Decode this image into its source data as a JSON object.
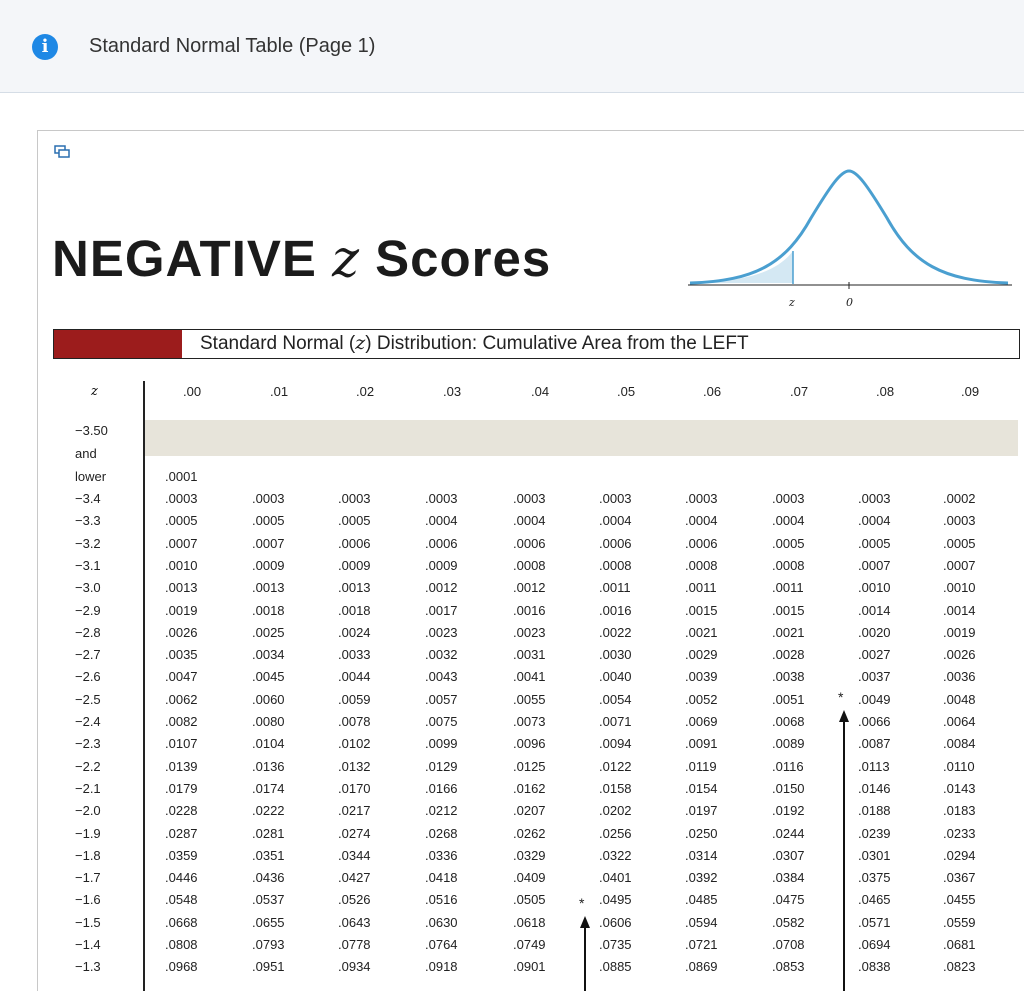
{
  "header": {
    "title": "Standard Normal Table (Page 1)",
    "icon": "info-icon"
  },
  "figure": {
    "title_prefix": "NEGATIVE ",
    "title_z": "z",
    "title_suffix": " Scores",
    "curve": {
      "label_z": "z",
      "label_zero": "0",
      "color": "#4a9fd0",
      "shade": "#d4e8f3"
    },
    "distribution_label_pre": "Standard Normal (",
    "distribution_label_z": "z",
    "distribution_label_post": ") Distribution: Cumulative Area from the LEFT",
    "accent": "#9c1c1c"
  },
  "table": {
    "z_header": "z",
    "columns": [
      ".00",
      ".01",
      ".02",
      ".03",
      ".04",
      ".05",
      ".06",
      ".07",
      ".08",
      ".09"
    ],
    "first_row": {
      "z": [
        "−3.50",
        "and",
        "lower"
      ],
      "values": [
        ".0001"
      ]
    },
    "rows": [
      {
        "z": "−3.4",
        "values": [
          ".0003",
          ".0003",
          ".0003",
          ".0003",
          ".0003",
          ".0003",
          ".0003",
          ".0003",
          ".0003",
          ".0002"
        ]
      },
      {
        "z": "−3.3",
        "values": [
          ".0005",
          ".0005",
          ".0005",
          ".0004",
          ".0004",
          ".0004",
          ".0004",
          ".0004",
          ".0004",
          ".0003"
        ]
      },
      {
        "z": "−3.2",
        "values": [
          ".0007",
          ".0007",
          ".0006",
          ".0006",
          ".0006",
          ".0006",
          ".0006",
          ".0005",
          ".0005",
          ".0005"
        ]
      },
      {
        "z": "−3.1",
        "values": [
          ".0010",
          ".0009",
          ".0009",
          ".0009",
          ".0008",
          ".0008",
          ".0008",
          ".0008",
          ".0007",
          ".0007"
        ]
      },
      {
        "z": "−3.0",
        "values": [
          ".0013",
          ".0013",
          ".0013",
          ".0012",
          ".0012",
          ".0011",
          ".0011",
          ".0011",
          ".0010",
          ".0010"
        ]
      },
      {
        "z": "−2.9",
        "values": [
          ".0019",
          ".0018",
          ".0018",
          ".0017",
          ".0016",
          ".0016",
          ".0015",
          ".0015",
          ".0014",
          ".0014"
        ]
      },
      {
        "z": "−2.8",
        "values": [
          ".0026",
          ".0025",
          ".0024",
          ".0023",
          ".0023",
          ".0022",
          ".0021",
          ".0021",
          ".0020",
          ".0019"
        ]
      },
      {
        "z": "−2.7",
        "values": [
          ".0035",
          ".0034",
          ".0033",
          ".0032",
          ".0031",
          ".0030",
          ".0029",
          ".0028",
          ".0027",
          ".0026"
        ]
      },
      {
        "z": "−2.6",
        "values": [
          ".0047",
          ".0045",
          ".0044",
          ".0043",
          ".0041",
          ".0040",
          ".0039",
          ".0038",
          ".0037",
          ".0036"
        ]
      },
      {
        "z": "−2.5",
        "values": [
          ".0062",
          ".0060",
          ".0059",
          ".0057",
          ".0055",
          ".0054",
          ".0052",
          ".0051",
          ".0049",
          ".0048"
        ]
      },
      {
        "z": "−2.4",
        "values": [
          ".0082",
          ".0080",
          ".0078",
          ".0075",
          ".0073",
          ".0071",
          ".0069",
          ".0068",
          ".0066",
          ".0064"
        ]
      },
      {
        "z": "−2.3",
        "values": [
          ".0107",
          ".0104",
          ".0102",
          ".0099",
          ".0096",
          ".0094",
          ".0091",
          ".0089",
          ".0087",
          ".0084"
        ]
      },
      {
        "z": "−2.2",
        "values": [
          ".0139",
          ".0136",
          ".0132",
          ".0129",
          ".0125",
          ".0122",
          ".0119",
          ".0116",
          ".0113",
          ".0110"
        ]
      },
      {
        "z": "−2.1",
        "values": [
          ".0179",
          ".0174",
          ".0170",
          ".0166",
          ".0162",
          ".0158",
          ".0154",
          ".0150",
          ".0146",
          ".0143"
        ]
      },
      {
        "z": "−2.0",
        "values": [
          ".0228",
          ".0222",
          ".0217",
          ".0212",
          ".0207",
          ".0202",
          ".0197",
          ".0192",
          ".0188",
          ".0183"
        ]
      },
      {
        "z": "−1.9",
        "values": [
          ".0287",
          ".0281",
          ".0274",
          ".0268",
          ".0262",
          ".0256",
          ".0250",
          ".0244",
          ".0239",
          ".0233"
        ]
      },
      {
        "z": "−1.8",
        "values": [
          ".0359",
          ".0351",
          ".0344",
          ".0336",
          ".0329",
          ".0322",
          ".0314",
          ".0307",
          ".0301",
          ".0294"
        ]
      },
      {
        "z": "−1.7",
        "values": [
          ".0446",
          ".0436",
          ".0427",
          ".0418",
          ".0409",
          ".0401",
          ".0392",
          ".0384",
          ".0375",
          ".0367"
        ]
      },
      {
        "z": "−1.6",
        "values": [
          ".0548",
          ".0537",
          ".0526",
          ".0516",
          ".0505",
          ".0495",
          ".0485",
          ".0475",
          ".0465",
          ".0455"
        ]
      },
      {
        "z": "−1.5",
        "values": [
          ".0668",
          ".0655",
          ".0643",
          ".0630",
          ".0618",
          ".0606",
          ".0594",
          ".0582",
          ".0571",
          ".0559"
        ]
      },
      {
        "z": "−1.4",
        "values": [
          ".0808",
          ".0793",
          ".0778",
          ".0764",
          ".0749",
          ".0735",
          ".0721",
          ".0708",
          ".0694",
          ".0681"
        ]
      },
      {
        "z": "−1.3",
        "values": [
          ".0968",
          ".0951",
          ".0934",
          ".0918",
          ".0901",
          ".0885",
          ".0869",
          ".0853",
          ".0838",
          ".0823"
        ]
      }
    ],
    "markers": {
      "symbol": "*"
    }
  }
}
